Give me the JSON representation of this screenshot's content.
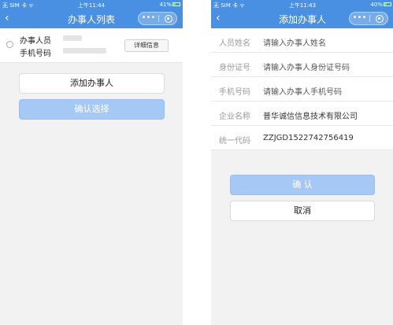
{
  "left": {
    "status": {
      "carrier": "无 SIM 卡 ᯤ",
      "time": "上午11:44",
      "battery": "41%"
    },
    "nav": {
      "title": "办事人列表",
      "back_icon": "‹",
      "more_icon": "•••"
    },
    "agent": {
      "name_label": "办事人员",
      "phone_label": "手机号码",
      "detail_label": "详细信息"
    },
    "add_label": "添加办事人",
    "confirm_label": "确认选择"
  },
  "right": {
    "status": {
      "carrier": "无 SIM 卡 ᯤ",
      "time": "上午11:43",
      "battery": "40%"
    },
    "nav": {
      "title": "添加办事人",
      "back_icon": "‹",
      "more_icon": "•••"
    },
    "form": {
      "name": {
        "label": "人员姓名",
        "placeholder": "请输入办事人姓名"
      },
      "id": {
        "label": "身份证号",
        "placeholder": "请输入办事人身份证号码"
      },
      "phone": {
        "label": "手机号码",
        "placeholder": "请输入办事人手机号码"
      },
      "company": {
        "label": "企业名称",
        "value": "普华诚信信息技术有限公司"
      },
      "code": {
        "label": "统一代码",
        "value": "ZZJGD1522742756419"
      }
    },
    "confirm_label": "确 认",
    "cancel_label": "取消"
  },
  "colors": {
    "nav": "#4a90e2",
    "confirm_disabled": "#a6c8f4"
  }
}
